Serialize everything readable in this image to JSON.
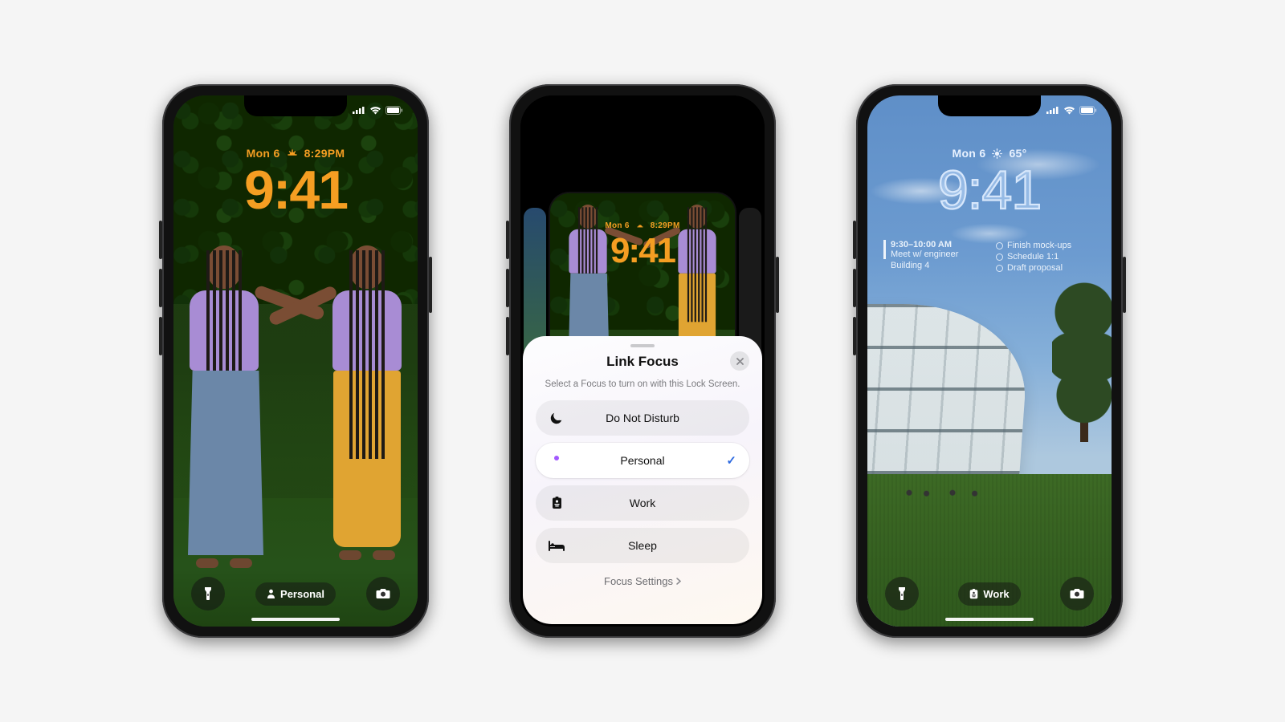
{
  "phone1": {
    "status": {
      "signal": 4,
      "wifi": true,
      "battery": 100
    },
    "date_label": "Mon 6",
    "weather_label": "8:29PM",
    "time": "9:41",
    "focus_pill": "Personal"
  },
  "phone2": {
    "mini": {
      "date_label": "Mon 6",
      "weather_label": "8:29PM",
      "time": "9:41"
    },
    "sheet": {
      "title": "Link Focus",
      "subtitle": "Select a Focus to turn on with this Lock Screen.",
      "options": [
        {
          "icon": "moon",
          "label": "Do Not Disturb",
          "selected": false
        },
        {
          "icon": "person",
          "label": "Personal",
          "selected": true,
          "icon_color": "#a259ff"
        },
        {
          "icon": "badge",
          "label": "Work",
          "selected": false
        },
        {
          "icon": "bed",
          "label": "Sleep",
          "selected": false
        }
      ],
      "settings_label": "Focus Settings"
    }
  },
  "phone3": {
    "status": {
      "signal": 4,
      "wifi": true,
      "battery": 100
    },
    "date_label": "Mon 6",
    "temp_label": "65°",
    "time": "9:41",
    "widgets": {
      "calendar": {
        "time": "9:30–10:00 AM",
        "title": "Meet w/ engineer",
        "location": "Building 4"
      },
      "reminders": [
        "Finish mock-ups",
        "Schedule 1:1",
        "Draft proposal"
      ]
    },
    "focus_pill": "Work"
  }
}
